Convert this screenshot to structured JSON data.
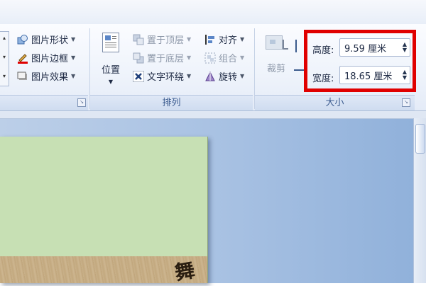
{
  "picture_group": {
    "shape_label": "图片形状",
    "border_label": "图片边框",
    "effects_label": "图片效果"
  },
  "arrange_group": {
    "position_label": "位置",
    "bring_front_label": "置于顶层",
    "send_back_label": "置于底层",
    "text_wrap_label": "文字环绕",
    "align_label": "对齐",
    "group_label": "组合",
    "rotate_label": "旋转",
    "footer": "排列"
  },
  "size_group": {
    "crop_label": "裁剪",
    "height_label": "高度:",
    "height_value": "9.59 厘米",
    "width_label": "宽度:",
    "width_value": "18.65 厘米",
    "footer": "大小"
  },
  "document": {
    "calligraphy": "舞"
  },
  "colors": {
    "highlight": "#e00000",
    "page_fill": "#c7e0b4",
    "ribbon_footer_text": "#3b5b8f"
  }
}
